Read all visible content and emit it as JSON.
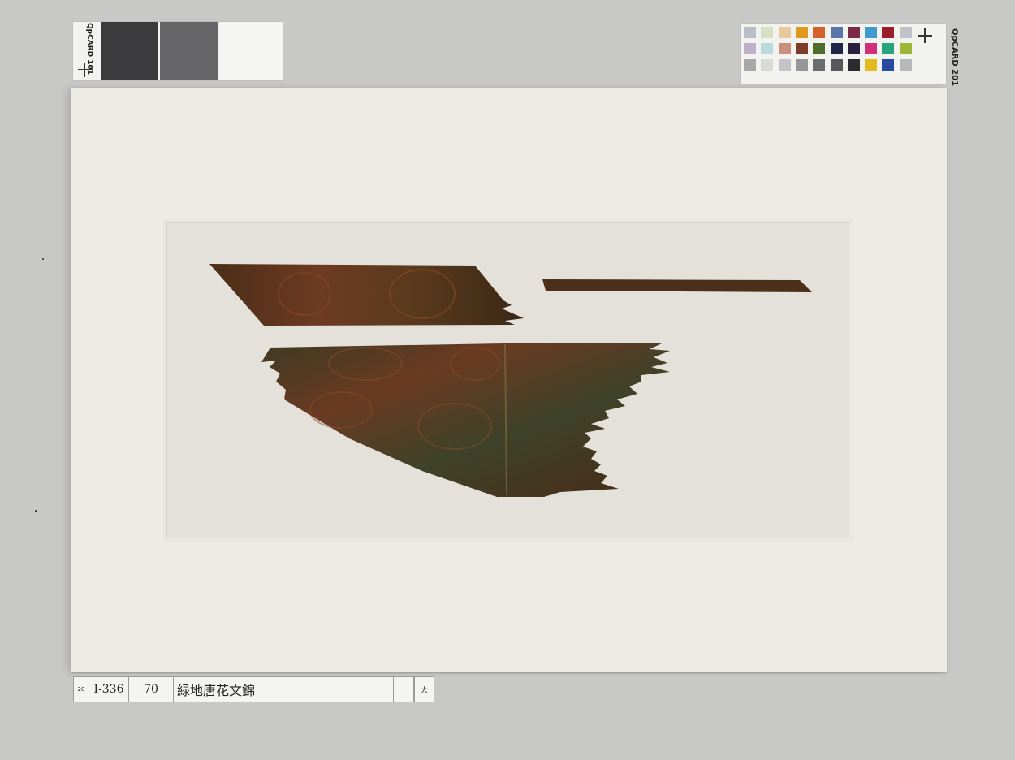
{
  "gray_card": {
    "brand": "QpCARD 101",
    "patches": [
      "#3b3b3d",
      "#666668",
      "#f5f5f3"
    ]
  },
  "color_card": {
    "brand": "QpCARD 201",
    "swatches": [
      [
        "#b9bec8",
        "#d7e0c4",
        "#e9c89a",
        "#df9a1e",
        "#d4622d",
        "#5b76a8",
        "#7c2a48",
        "#3f9ad0",
        "#9c1d2a",
        "#c0c2c8"
      ],
      [
        "#c0aecb",
        "#b9dadb",
        "#c99080",
        "#7d3b2a",
        "#4f6d2a",
        "#1e2747",
        "#2b1f3e",
        "#d03079",
        "#27a37d",
        "#9db734"
      ],
      [
        "#a8a8aa",
        "#d8dad6",
        "#c1c3c5",
        "#959799",
        "#6a6c6e",
        "#55575a",
        "#2a2b2e",
        "#e6b91d",
        "#2749a0",
        "#b6b8ba"
      ]
    ]
  },
  "label": {
    "num_small": "20",
    "inventory": "I-336",
    "count": "70",
    "title": "緑地唐花文錦",
    "size_mark": "大"
  },
  "colors": {
    "background": "#c8c8c6",
    "mount": "#ecebe4",
    "window": "#e4e0da",
    "textile_dark": "#3d2a18",
    "textile_red": "#7a3a22",
    "textile_green": "#3e4a2a"
  }
}
